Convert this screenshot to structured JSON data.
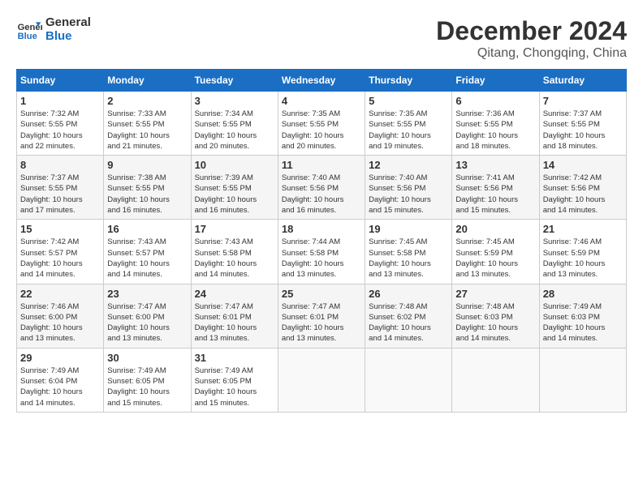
{
  "logo": {
    "line1": "General",
    "line2": "Blue"
  },
  "title": "December 2024",
  "subtitle": "Qitang, Chongqing, China",
  "weekdays": [
    "Sunday",
    "Monday",
    "Tuesday",
    "Wednesday",
    "Thursday",
    "Friday",
    "Saturday"
  ],
  "weeks": [
    [
      {
        "day": "1",
        "detail": "Sunrise: 7:32 AM\nSunset: 5:55 PM\nDaylight: 10 hours\nand 22 minutes."
      },
      {
        "day": "2",
        "detail": "Sunrise: 7:33 AM\nSunset: 5:55 PM\nDaylight: 10 hours\nand 21 minutes."
      },
      {
        "day": "3",
        "detail": "Sunrise: 7:34 AM\nSunset: 5:55 PM\nDaylight: 10 hours\nand 20 minutes."
      },
      {
        "day": "4",
        "detail": "Sunrise: 7:35 AM\nSunset: 5:55 PM\nDaylight: 10 hours\nand 20 minutes."
      },
      {
        "day": "5",
        "detail": "Sunrise: 7:35 AM\nSunset: 5:55 PM\nDaylight: 10 hours\nand 19 minutes."
      },
      {
        "day": "6",
        "detail": "Sunrise: 7:36 AM\nSunset: 5:55 PM\nDaylight: 10 hours\nand 18 minutes."
      },
      {
        "day": "7",
        "detail": "Sunrise: 7:37 AM\nSunset: 5:55 PM\nDaylight: 10 hours\nand 18 minutes."
      }
    ],
    [
      {
        "day": "8",
        "detail": "Sunrise: 7:37 AM\nSunset: 5:55 PM\nDaylight: 10 hours\nand 17 minutes."
      },
      {
        "day": "9",
        "detail": "Sunrise: 7:38 AM\nSunset: 5:55 PM\nDaylight: 10 hours\nand 16 minutes."
      },
      {
        "day": "10",
        "detail": "Sunrise: 7:39 AM\nSunset: 5:55 PM\nDaylight: 10 hours\nand 16 minutes."
      },
      {
        "day": "11",
        "detail": "Sunrise: 7:40 AM\nSunset: 5:56 PM\nDaylight: 10 hours\nand 16 minutes."
      },
      {
        "day": "12",
        "detail": "Sunrise: 7:40 AM\nSunset: 5:56 PM\nDaylight: 10 hours\nand 15 minutes."
      },
      {
        "day": "13",
        "detail": "Sunrise: 7:41 AM\nSunset: 5:56 PM\nDaylight: 10 hours\nand 15 minutes."
      },
      {
        "day": "14",
        "detail": "Sunrise: 7:42 AM\nSunset: 5:56 PM\nDaylight: 10 hours\nand 14 minutes."
      }
    ],
    [
      {
        "day": "15",
        "detail": "Sunrise: 7:42 AM\nSunset: 5:57 PM\nDaylight: 10 hours\nand 14 minutes."
      },
      {
        "day": "16",
        "detail": "Sunrise: 7:43 AM\nSunset: 5:57 PM\nDaylight: 10 hours\nand 14 minutes."
      },
      {
        "day": "17",
        "detail": "Sunrise: 7:43 AM\nSunset: 5:58 PM\nDaylight: 10 hours\nand 14 minutes."
      },
      {
        "day": "18",
        "detail": "Sunrise: 7:44 AM\nSunset: 5:58 PM\nDaylight: 10 hours\nand 13 minutes."
      },
      {
        "day": "19",
        "detail": "Sunrise: 7:45 AM\nSunset: 5:58 PM\nDaylight: 10 hours\nand 13 minutes."
      },
      {
        "day": "20",
        "detail": "Sunrise: 7:45 AM\nSunset: 5:59 PM\nDaylight: 10 hours\nand 13 minutes."
      },
      {
        "day": "21",
        "detail": "Sunrise: 7:46 AM\nSunset: 5:59 PM\nDaylight: 10 hours\nand 13 minutes."
      }
    ],
    [
      {
        "day": "22",
        "detail": "Sunrise: 7:46 AM\nSunset: 6:00 PM\nDaylight: 10 hours\nand 13 minutes."
      },
      {
        "day": "23",
        "detail": "Sunrise: 7:47 AM\nSunset: 6:00 PM\nDaylight: 10 hours\nand 13 minutes."
      },
      {
        "day": "24",
        "detail": "Sunrise: 7:47 AM\nSunset: 6:01 PM\nDaylight: 10 hours\nand 13 minutes."
      },
      {
        "day": "25",
        "detail": "Sunrise: 7:47 AM\nSunset: 6:01 PM\nDaylight: 10 hours\nand 13 minutes."
      },
      {
        "day": "26",
        "detail": "Sunrise: 7:48 AM\nSunset: 6:02 PM\nDaylight: 10 hours\nand 14 minutes."
      },
      {
        "day": "27",
        "detail": "Sunrise: 7:48 AM\nSunset: 6:03 PM\nDaylight: 10 hours\nand 14 minutes."
      },
      {
        "day": "28",
        "detail": "Sunrise: 7:49 AM\nSunset: 6:03 PM\nDaylight: 10 hours\nand 14 minutes."
      }
    ],
    [
      {
        "day": "29",
        "detail": "Sunrise: 7:49 AM\nSunset: 6:04 PM\nDaylight: 10 hours\nand 14 minutes."
      },
      {
        "day": "30",
        "detail": "Sunrise: 7:49 AM\nSunset: 6:05 PM\nDaylight: 10 hours\nand 15 minutes."
      },
      {
        "day": "31",
        "detail": "Sunrise: 7:49 AM\nSunset: 6:05 PM\nDaylight: 10 hours\nand 15 minutes."
      },
      {
        "day": "",
        "detail": ""
      },
      {
        "day": "",
        "detail": ""
      },
      {
        "day": "",
        "detail": ""
      },
      {
        "day": "",
        "detail": ""
      }
    ]
  ]
}
